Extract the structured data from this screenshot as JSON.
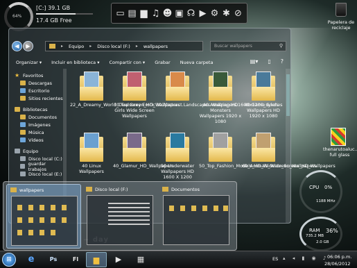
{
  "drive_gauge": {
    "percent": "64%",
    "title": "[C:] 39.1 GB",
    "free": "17.4 GB Free",
    "used_fraction": 0.69
  },
  "dock": {
    "icons": [
      "monitor-icon",
      "document-icon",
      "folder-icon",
      "music-icon",
      "user-icon",
      "image-icon",
      "headphones-icon",
      "video-icon",
      "gear-icon",
      "network-icon",
      "search-icon"
    ],
    "glyphs": [
      "▭",
      "▤",
      "▆",
      "♫",
      "☻",
      "▣",
      "☊",
      "▶",
      "⚙",
      "✱",
      "⊘"
    ]
  },
  "desktop": {
    "recycle_bin_label": "Papelera de reciclaje",
    "shortcut_label": "thenarutoaluc... full glass"
  },
  "window": {
    "breadcrumbs": [
      "Equipo",
      "Disco local (F:)",
      "wallpapers"
    ],
    "search_placeholder": "Buscar wallpapers",
    "toolbar": [
      "Organizar ▾",
      "Incluir en biblioteca ▾",
      "Compartir con ▾",
      "Grabar",
      "Nueva carpeta"
    ],
    "sidebar": {
      "favorites": {
        "label": "Favoritos",
        "items": [
          "Descargas",
          "Escritorio",
          "Sitios recientes"
        ]
      },
      "libraries": {
        "label": "Bibliotecas",
        "items": [
          "Documentos",
          "Imágenes",
          "Música",
          "Vídeos"
        ]
      },
      "computer": {
        "label": "Equipo",
        "items": [
          "Disco local (C:)",
          "guardar trabajos",
          "Disco local (E:)"
        ]
      }
    },
    "files": [
      "22_A_Dreamy_World_Dualscreen_HD_Wallpapers",
      "30 Top Sexy Erotic Girls Wide Screen Wallpapers",
      "30.Abstract.Landscapes.Wallpapers.1600x1200_sykdL",
      "40 Amazing HD Monsters Wallpapers 1920 x 1080",
      "40 Game Scenes Wallpapers HD 1920 x 1080",
      "40 Linux Wallpapers",
      "40_Glamur_HD_Wallpapers",
      "50 Underwater Wallpapers HD 1600 X 1200",
      "50_Top_Fashion_Models_HD_Widescreen_Wallpapers",
      "60_Animals_Wide_Screen_HD_Wallpapers"
    ]
  },
  "thumbnails": [
    "wallpapers",
    "Disco local (F:)",
    "Documentos"
  ],
  "gadgets": {
    "cpu_label": "CPU",
    "cpu_value": "0%",
    "cpu_freq": "1188 MHz",
    "ram_label": "RAM",
    "ram_value": "36%",
    "ram_used": "735.2 MB",
    "ram_total": "2.0 GB"
  },
  "taskbar": {
    "apps": [
      "IE",
      "Ps",
      "Fl",
      "Explorer",
      "Play",
      "Media"
    ],
    "language": "ES",
    "time": "06:06 p.m.",
    "date": "28/06/2012"
  }
}
